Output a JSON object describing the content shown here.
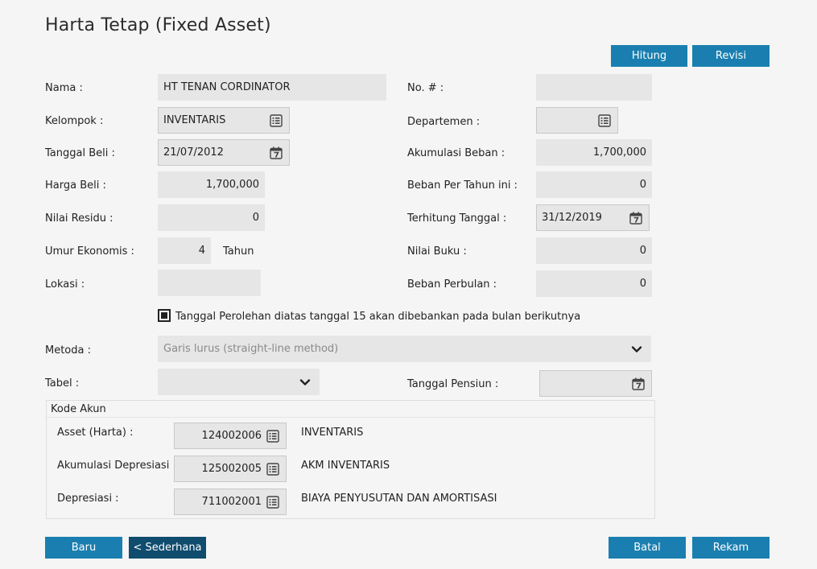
{
  "title": "Harta Tetap (Fixed Asset)",
  "top_buttons": {
    "hitung": "Hitung",
    "revisi": "Revisi"
  },
  "left": {
    "nama": {
      "label": "Nama :",
      "value": "HT  TENAN CORDINATOR"
    },
    "kelompok": {
      "label": "Kelompok :",
      "value": "INVENTARIS"
    },
    "tanggal_beli": {
      "label": "Tanggal Beli :",
      "value": "21/07/2012"
    },
    "harga_beli": {
      "label": "Harga Beli :",
      "value": "1,700,000"
    },
    "nilai_residu": {
      "label": "Nilai Residu :",
      "value": "0"
    },
    "umur_ekonomis": {
      "label": "Umur Ekonomis :",
      "value": "4",
      "unit": "Tahun"
    },
    "lokasi": {
      "label": "Lokasi :",
      "value": ""
    }
  },
  "right": {
    "no": {
      "label": "No. # :",
      "value": ""
    },
    "departemen": {
      "label": "Departemen :",
      "value": ""
    },
    "akumulasi_beban": {
      "label": "Akumulasi Beban :",
      "value": "1,700,000"
    },
    "beban_per_tahun": {
      "label": "Beban Per Tahun ini :",
      "value": "0"
    },
    "terhitung_tanggal": {
      "label": "Terhitung Tanggal :",
      "value": "31/12/2019"
    },
    "nilai_buku": {
      "label": "Nilai Buku :",
      "value": "0"
    },
    "beban_perbulan": {
      "label": "Beban Perbulan :",
      "value": "0"
    },
    "tanggal_pensiun": {
      "label": "Tanggal Pensiun :",
      "value": ""
    }
  },
  "checkbox": {
    "label": "Tanggal Perolehan diatas tanggal 15 akan dibebankan pada bulan berikutnya",
    "checked": true
  },
  "metoda": {
    "label": "Metoda :",
    "value": "Garis lurus (straight-line method)"
  },
  "tabel": {
    "label": "Tabel :",
    "value": ""
  },
  "kode_akun": {
    "title": "Kode Akun",
    "rows": [
      {
        "label": "Asset (Harta) :",
        "code": "124002006",
        "name": "INVENTARIS"
      },
      {
        "label": "Akumulasi Depresiasi :",
        "code": "125002005",
        "name": "AKM INVENTARIS"
      },
      {
        "label": "Depresiasi :",
        "code": "711002001",
        "name": "BIAYA PENYUSUTAN DAN AMORTISASI"
      }
    ]
  },
  "bottom_buttons": {
    "baru": "Baru",
    "sederhana": "< Sederhana",
    "batal": "Batal",
    "rekam": "Rekam"
  },
  "colors": {
    "button": "#1a7fb0",
    "button_dark": "#0f4c6e",
    "field_bg": "#e6e6e6",
    "page_bg": "#f5f5f5"
  },
  "icons": {
    "lookup": "list-icon",
    "date": "calendar-icon",
    "dropdown": "chevron-down-icon"
  }
}
